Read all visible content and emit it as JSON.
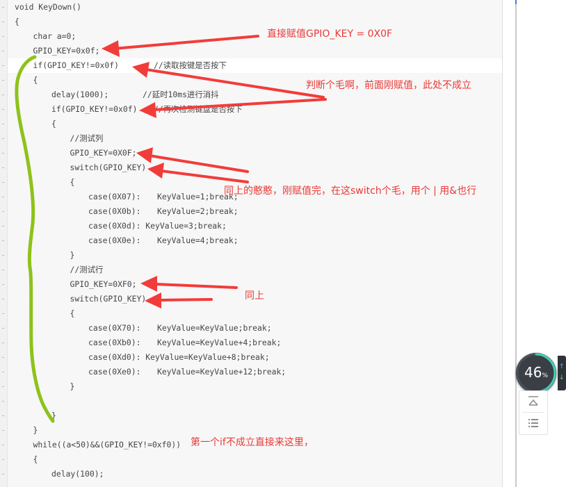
{
  "code_lines": [
    {
      "indent": 0,
      "text": "void KeyDown()"
    },
    {
      "indent": 0,
      "text": "{"
    },
    {
      "indent": 1,
      "text": "char a=0;"
    },
    {
      "indent": 1,
      "text": "GPIO_KEY=0x0f;"
    },
    {
      "indent": 1,
      "text": "if(GPIO_KEY!=0x0f)",
      "comment": "//读取按键是否按下"
    },
    {
      "indent": 1,
      "text": "{"
    },
    {
      "indent": 2,
      "text": "delay(1000);",
      "comment": "//延时10ms进行消抖"
    },
    {
      "indent": 2,
      "text": "if(GPIO_KEY!=0x0f)",
      "comment": "//再次检测键盘是否按下"
    },
    {
      "indent": 2,
      "text": "{"
    },
    {
      "indent": 3,
      "text": "//测试列"
    },
    {
      "indent": 3,
      "text": "GPIO_KEY=0X0F;"
    },
    {
      "indent": 3,
      "text": "switch(GPIO_KEY)"
    },
    {
      "indent": 3,
      "text": "{"
    },
    {
      "indent": 4,
      "text": "case(0X07):",
      "tail": "KeyValue=1;break;"
    },
    {
      "indent": 4,
      "text": "case(0X0b):",
      "tail": "KeyValue=2;break;"
    },
    {
      "indent": 4,
      "text": "case(0X0d): KeyValue=3;break;"
    },
    {
      "indent": 4,
      "text": "case(0X0e):",
      "tail": "KeyValue=4;break;"
    },
    {
      "indent": 3,
      "text": "}"
    },
    {
      "indent": 3,
      "text": "//测试行"
    },
    {
      "indent": 3,
      "text": "GPIO_KEY=0XF0;"
    },
    {
      "indent": 3,
      "text": "switch(GPIO_KEY)"
    },
    {
      "indent": 3,
      "text": "{"
    },
    {
      "indent": 4,
      "text": "case(0X70):",
      "tail": "KeyValue=KeyValue;break;"
    },
    {
      "indent": 4,
      "text": "case(0Xb0):",
      "tail": "KeyValue=KeyValue+4;break;"
    },
    {
      "indent": 4,
      "text": "case(0Xd0): KeyValue=KeyValue+8;break;"
    },
    {
      "indent": 4,
      "text": "case(0Xe0):",
      "tail": "KeyValue=KeyValue+12;break;"
    },
    {
      "indent": 3,
      "text": "}"
    },
    {
      "indent": 0,
      "text": ""
    },
    {
      "indent": 2,
      "text": "}"
    },
    {
      "indent": 1,
      "text": "}"
    },
    {
      "indent": 1,
      "text": "while((a<50)&&(GPIO_KEY!=0xf0))"
    },
    {
      "indent": 1,
      "text": "{"
    },
    {
      "indent": 2,
      "text": "delay(100);"
    }
  ],
  "annotations": {
    "direct_assign": "直接赋值GPIO_KEY = 0X0F",
    "judge_pointless": "判断个毛啊，前面刚赋值，此处不成立",
    "same_silly": "同上的憨憨，刚赋值完，在这switch个毛，用个 | 用&也行",
    "same_as_above": "同上",
    "first_if_fails": "第一个if不成立直接来这里，"
  },
  "speed_widget": {
    "percent": 46,
    "value_text": "46",
    "unit": "%",
    "up_arrow": "↑",
    "down_arrow": "↓"
  },
  "tool_buttons": [
    {
      "icon": "scroll-to-top-icon"
    },
    {
      "icon": "list-menu-icon"
    }
  ],
  "colors": {
    "annotation_red": "#e83a36",
    "bracket_green": "#8ec21a",
    "code_text": "#444444",
    "code_background": "#f7f7f7"
  }
}
